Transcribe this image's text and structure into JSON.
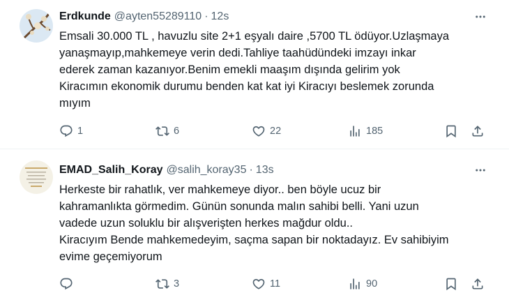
{
  "tweets": [
    {
      "name": "Erdkunde",
      "handle": "@ayten55289110",
      "separator": "·",
      "time": "12s",
      "lines": [
        "Emsali 30.000 TL , havuzlu site 2+1 eşyalı daire ,5700 TL ödüyor.Uzlaşmaya",
        "yanaşmayıp,mahkemeye verin dedi.Tahliye taahüdündeki imzayı inkar",
        "ederek zaman kazanıyor.Benim emekli maaşım dışında gelirim yok",
        "Kiracımın ekonomik durumu benden kat kat iyi Kiracıyı beslemek zorunda",
        "mıyım"
      ],
      "stats": {
        "replies": "1",
        "reposts": "6",
        "likes": "22",
        "views": "185"
      },
      "avatar": {
        "sky": "#dbe8f3",
        "branch": "#6b4a2e"
      }
    },
    {
      "name": "EMAD_Salih_Koray",
      "handle": "@salih_koray35",
      "separator": "·",
      "time": "13s",
      "lines": [
        "Herkeste bir rahatlık, ver mahkemeye diyor.. ben böyle ucuz bir",
        "kahramanlıkta görmedim. Günün sonunda malın sahibi belli. Yani uzun",
        "vadede uzun soluklu bir alışverişten herkes mağdur oldu..",
        "Kiracıyım Bende mahkemedeyim, saçma sapan bir noktadayız. Ev sahibiyim",
        "evime geçemiyorum"
      ],
      "stats": {
        "replies": "",
        "reposts": "3",
        "likes": "11",
        "views": "90"
      },
      "avatar": {
        "bg": "#f4f1e6",
        "accent": "#c9a96a"
      }
    }
  ],
  "icons": [
    "reply-icon",
    "repost-icon",
    "like-icon",
    "views-icon",
    "bookmark-icon",
    "share-icon",
    "more-icon"
  ],
  "colors": {
    "text": "#0f1419",
    "secondary": "#536471",
    "divider": "#eff3f4"
  }
}
